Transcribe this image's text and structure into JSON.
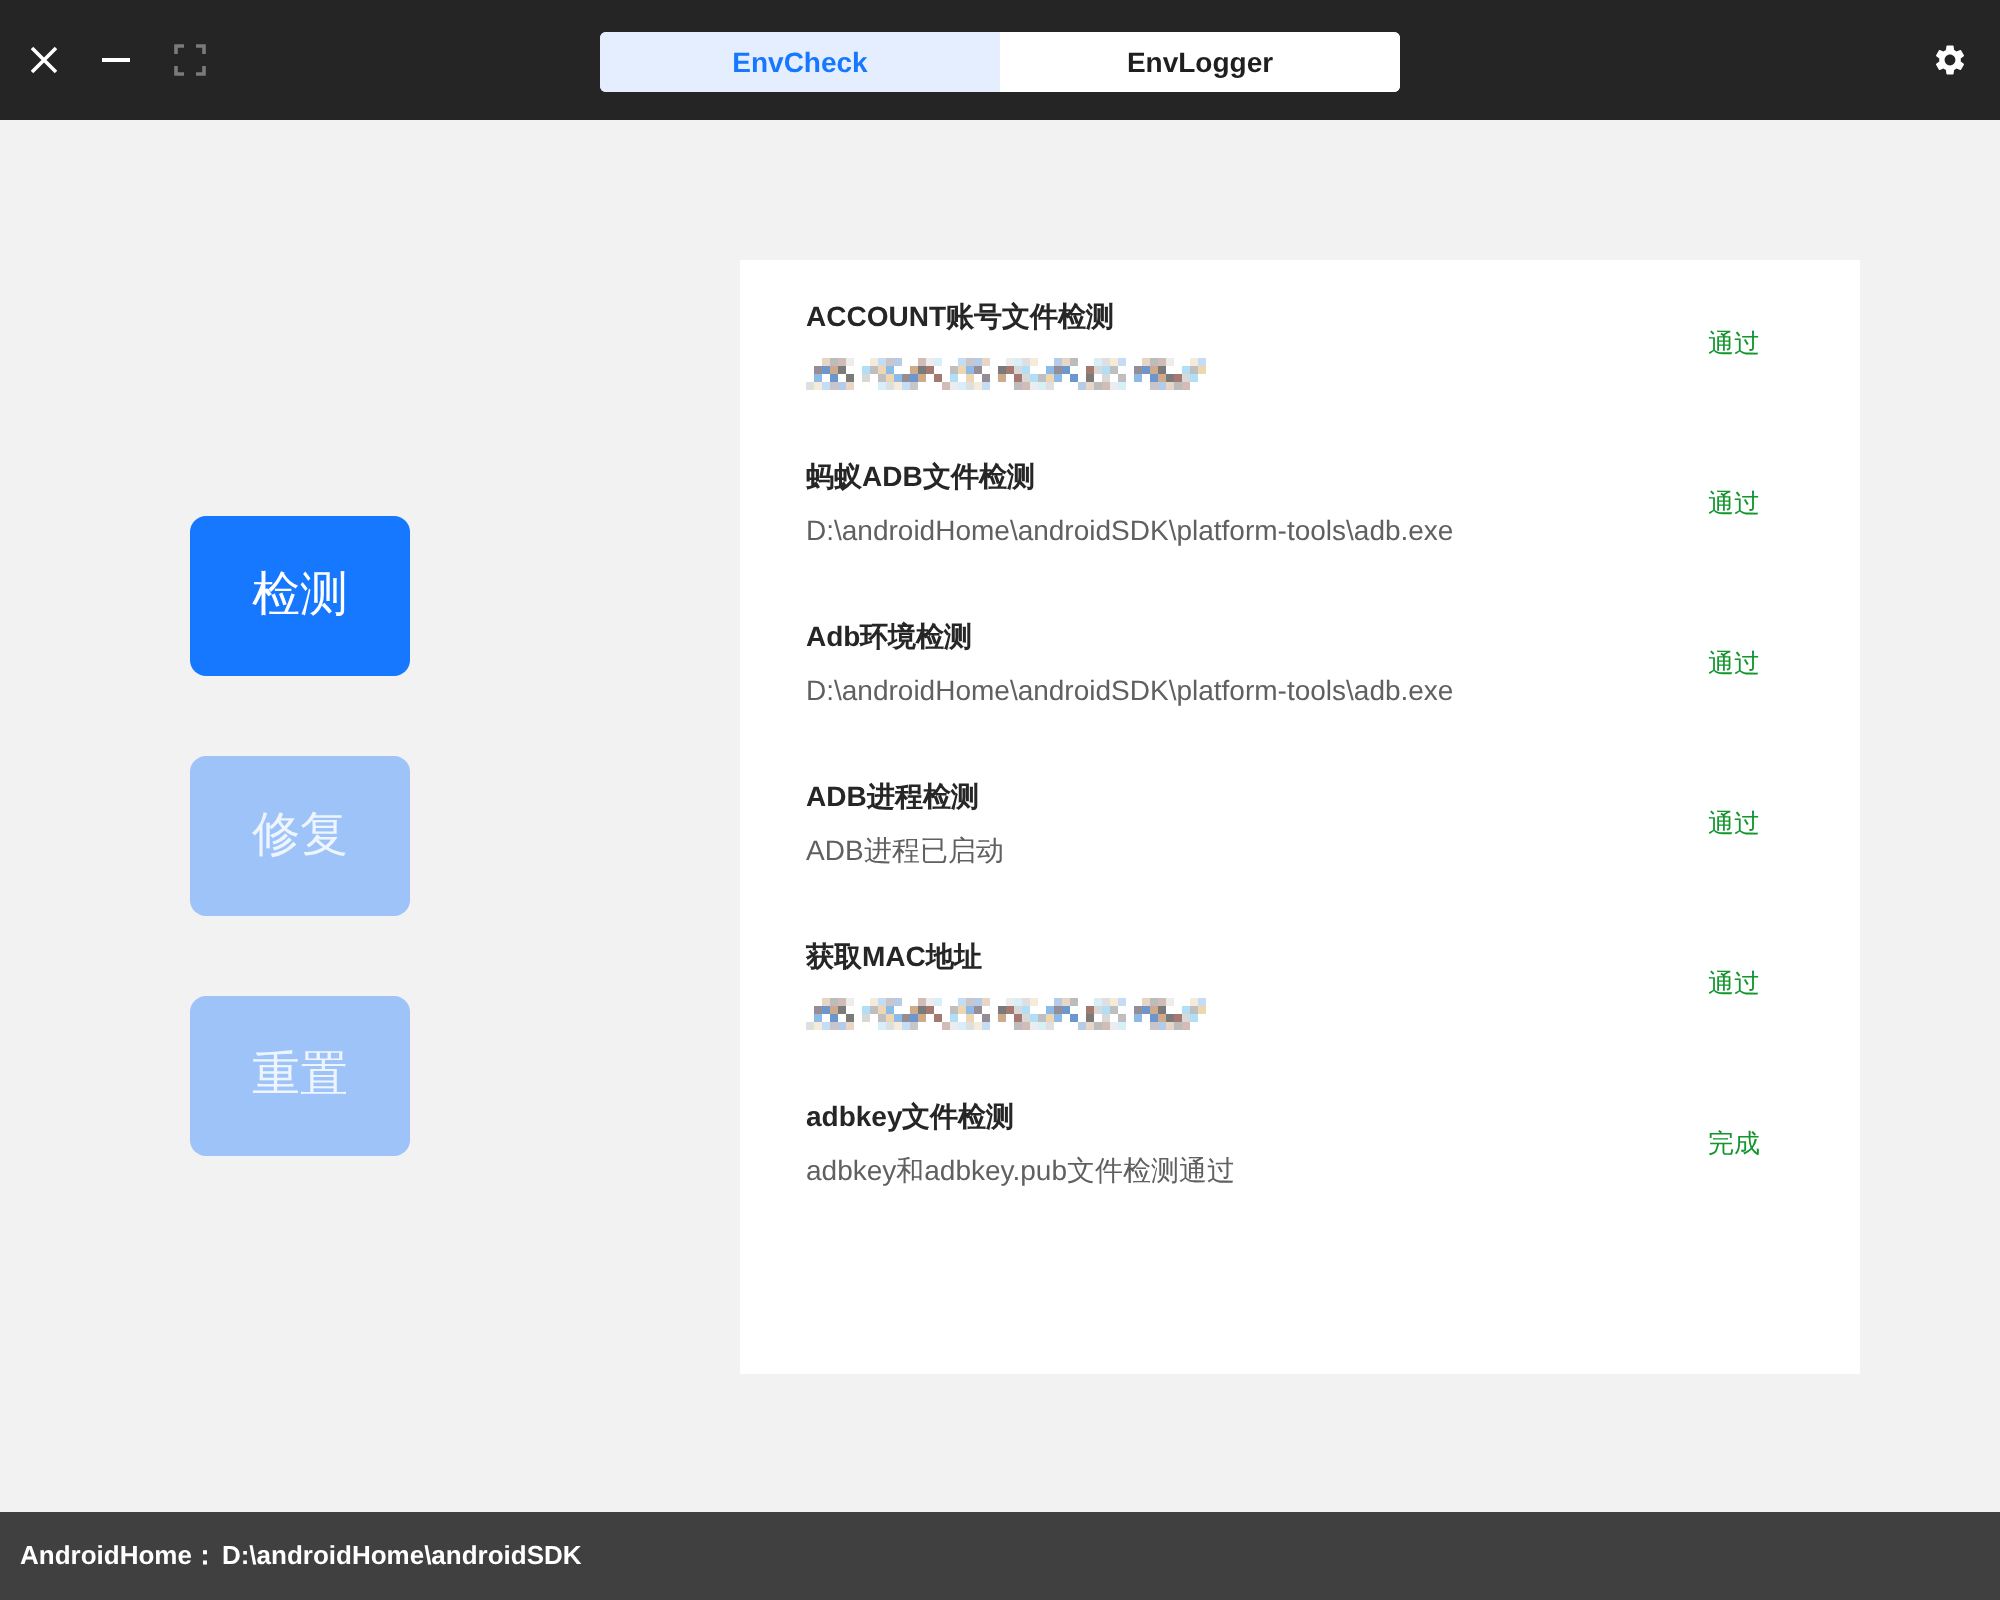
{
  "window": {
    "maximize": {
      "disabled": true
    }
  },
  "tabs": [
    {
      "label": "EnvCheck",
      "selected": true
    },
    {
      "label": "EnvLogger",
      "selected": false
    }
  ],
  "actions": [
    {
      "label": "检测",
      "disabled": false
    },
    {
      "label": "修复",
      "disabled": true
    },
    {
      "label": "重置",
      "disabled": true
    }
  ],
  "checks": [
    {
      "title": "ACCOUNT账号文件检测",
      "detail": {
        "kind": "pixelated"
      },
      "status": "通过"
    },
    {
      "title": "蚂蚁ADB文件检测",
      "detail": {
        "kind": "text",
        "text": "D:\\androidHome\\androidSDK\\platform-tools\\adb.exe"
      },
      "status": "通过"
    },
    {
      "title": "Adb环境检测",
      "detail": {
        "kind": "text",
        "text": "D:\\androidHome\\androidSDK\\platform-tools\\adb.exe"
      },
      "status": "通过"
    },
    {
      "title": "ADB进程检测",
      "detail": {
        "kind": "text",
        "text": "ADB进程已启动"
      },
      "status": "通过"
    },
    {
      "title": "获取MAC地址",
      "detail": {
        "kind": "pixelated"
      },
      "status": "通过"
    },
    {
      "title": "adbkey文件检测",
      "detail": {
        "kind": "text",
        "text": "adbkey和adbkey.pub文件检测通过"
      },
      "status": "完成"
    }
  ],
  "status_bar": {
    "label": "AndroidHome：",
    "value": "D:\\androidHome\\androidSDK"
  }
}
